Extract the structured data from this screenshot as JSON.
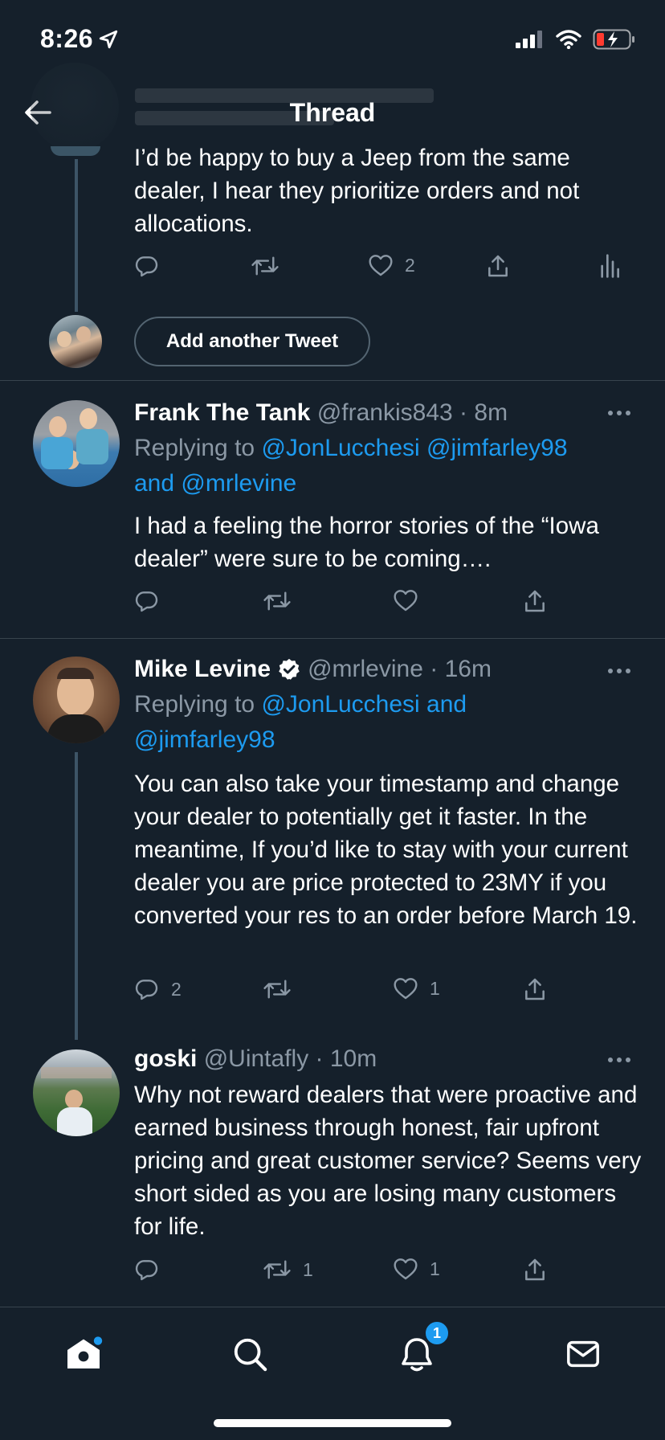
{
  "status_bar": {
    "time": "8:26"
  },
  "header": {
    "title": "Thread"
  },
  "tweets": [
    {
      "text": "I’d be happy to buy a Jeep from the same dealer, I hear they prioritize orders and not allocations.",
      "likes": "2"
    },
    {
      "name": "Frank The Tank",
      "handle": "@frankis843",
      "time": "8m",
      "replying_label": "Replying to",
      "replying_to": [
        "@JonLucchesi",
        "@jimfarley98",
        "and",
        "@mrlevine"
      ],
      "text": "I had a feeling the horror stories of the “Iowa  dealer” were sure to be coming…."
    },
    {
      "name": "Mike Levine",
      "handle": "@mrlevine",
      "time": "16m",
      "replying_label": "Replying to",
      "replying_to": [
        "@JonLucchesi",
        "and",
        "@jimfarley98"
      ],
      "text": "You can also take your timestamp and change your dealer to potentially get it faster. In the meantime, If you’d like to stay with your current dealer you are price protected to 23MY if you converted your res to an order before March 19.",
      "replies": "2",
      "likes": "1"
    },
    {
      "name": "goski",
      "handle": "@Uintafly",
      "time": "10m",
      "text": "Why not reward dealers that were proactive and earned business through honest, fair upfront pricing and great customer service? Seems very short sided as you are losing many customers for life.",
      "retweets": "1",
      "likes": "1"
    }
  ],
  "add_tweet": {
    "label": "Add another Tweet"
  },
  "tabbar": {
    "notifications_badge": "1"
  },
  "colors": {
    "background": "#15202b",
    "accent": "#1d9bf0",
    "muted": "#8b98a5",
    "divider": "#38444d"
  }
}
